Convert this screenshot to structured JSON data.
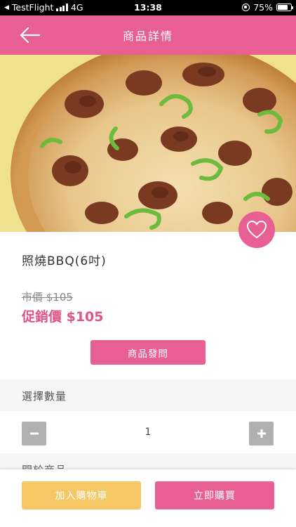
{
  "status_bar": {
    "carrier": "TestFlight",
    "network": "4G",
    "time": "13:38",
    "battery": "75%",
    "battery_level": 0.75
  },
  "nav": {
    "title": "商品詳情",
    "back_icon": "arrow-left-icon"
  },
  "product": {
    "image_icon": "pizza-photo",
    "favorite_icon": "heart-icon",
    "name": "照燒BBQ(6吋)",
    "original_price": "市價 $105",
    "promo_price": "促銷價 $105",
    "ask_button": "商品發問"
  },
  "quantity": {
    "label": "選擇數量",
    "value": "1",
    "minus_icon": "minus-icon",
    "plus_icon": "plus-icon"
  },
  "related": {
    "label": "開於商品"
  },
  "actions": {
    "add_to_cart": "加入購物車",
    "buy_now": "立即購買"
  },
  "colors": {
    "brand_pink": "#e85f93",
    "cart_yellow": "#f6c865",
    "section_gray": "#f5f5f5"
  }
}
